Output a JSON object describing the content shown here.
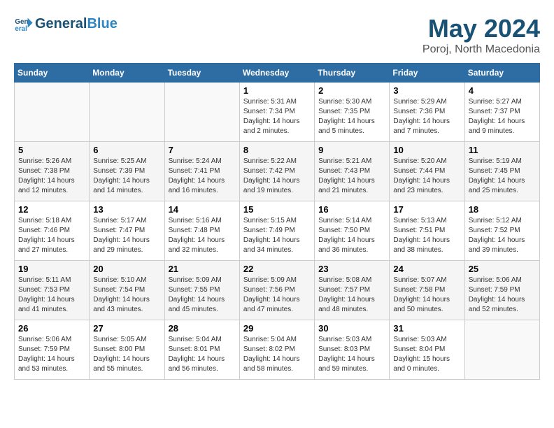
{
  "header": {
    "logo_general": "General",
    "logo_blue": "Blue",
    "month": "May 2024",
    "location": "Poroj, North Macedonia"
  },
  "days_of_week": [
    "Sunday",
    "Monday",
    "Tuesday",
    "Wednesday",
    "Thursday",
    "Friday",
    "Saturday"
  ],
  "weeks": [
    [
      {
        "day": "",
        "info": ""
      },
      {
        "day": "",
        "info": ""
      },
      {
        "day": "",
        "info": ""
      },
      {
        "day": "1",
        "info": "Sunrise: 5:31 AM\nSunset: 7:34 PM\nDaylight: 14 hours and 2 minutes."
      },
      {
        "day": "2",
        "info": "Sunrise: 5:30 AM\nSunset: 7:35 PM\nDaylight: 14 hours and 5 minutes."
      },
      {
        "day": "3",
        "info": "Sunrise: 5:29 AM\nSunset: 7:36 PM\nDaylight: 14 hours and 7 minutes."
      },
      {
        "day": "4",
        "info": "Sunrise: 5:27 AM\nSunset: 7:37 PM\nDaylight: 14 hours and 9 minutes."
      }
    ],
    [
      {
        "day": "5",
        "info": "Sunrise: 5:26 AM\nSunset: 7:38 PM\nDaylight: 14 hours and 12 minutes."
      },
      {
        "day": "6",
        "info": "Sunrise: 5:25 AM\nSunset: 7:39 PM\nDaylight: 14 hours and 14 minutes."
      },
      {
        "day": "7",
        "info": "Sunrise: 5:24 AM\nSunset: 7:41 PM\nDaylight: 14 hours and 16 minutes."
      },
      {
        "day": "8",
        "info": "Sunrise: 5:22 AM\nSunset: 7:42 PM\nDaylight: 14 hours and 19 minutes."
      },
      {
        "day": "9",
        "info": "Sunrise: 5:21 AM\nSunset: 7:43 PM\nDaylight: 14 hours and 21 minutes."
      },
      {
        "day": "10",
        "info": "Sunrise: 5:20 AM\nSunset: 7:44 PM\nDaylight: 14 hours and 23 minutes."
      },
      {
        "day": "11",
        "info": "Sunrise: 5:19 AM\nSunset: 7:45 PM\nDaylight: 14 hours and 25 minutes."
      }
    ],
    [
      {
        "day": "12",
        "info": "Sunrise: 5:18 AM\nSunset: 7:46 PM\nDaylight: 14 hours and 27 minutes."
      },
      {
        "day": "13",
        "info": "Sunrise: 5:17 AM\nSunset: 7:47 PM\nDaylight: 14 hours and 29 minutes."
      },
      {
        "day": "14",
        "info": "Sunrise: 5:16 AM\nSunset: 7:48 PM\nDaylight: 14 hours and 32 minutes."
      },
      {
        "day": "15",
        "info": "Sunrise: 5:15 AM\nSunset: 7:49 PM\nDaylight: 14 hours and 34 minutes."
      },
      {
        "day": "16",
        "info": "Sunrise: 5:14 AM\nSunset: 7:50 PM\nDaylight: 14 hours and 36 minutes."
      },
      {
        "day": "17",
        "info": "Sunrise: 5:13 AM\nSunset: 7:51 PM\nDaylight: 14 hours and 38 minutes."
      },
      {
        "day": "18",
        "info": "Sunrise: 5:12 AM\nSunset: 7:52 PM\nDaylight: 14 hours and 39 minutes."
      }
    ],
    [
      {
        "day": "19",
        "info": "Sunrise: 5:11 AM\nSunset: 7:53 PM\nDaylight: 14 hours and 41 minutes."
      },
      {
        "day": "20",
        "info": "Sunrise: 5:10 AM\nSunset: 7:54 PM\nDaylight: 14 hours and 43 minutes."
      },
      {
        "day": "21",
        "info": "Sunrise: 5:09 AM\nSunset: 7:55 PM\nDaylight: 14 hours and 45 minutes."
      },
      {
        "day": "22",
        "info": "Sunrise: 5:09 AM\nSunset: 7:56 PM\nDaylight: 14 hours and 47 minutes."
      },
      {
        "day": "23",
        "info": "Sunrise: 5:08 AM\nSunset: 7:57 PM\nDaylight: 14 hours and 48 minutes."
      },
      {
        "day": "24",
        "info": "Sunrise: 5:07 AM\nSunset: 7:58 PM\nDaylight: 14 hours and 50 minutes."
      },
      {
        "day": "25",
        "info": "Sunrise: 5:06 AM\nSunset: 7:59 PM\nDaylight: 14 hours and 52 minutes."
      }
    ],
    [
      {
        "day": "26",
        "info": "Sunrise: 5:06 AM\nSunset: 7:59 PM\nDaylight: 14 hours and 53 minutes."
      },
      {
        "day": "27",
        "info": "Sunrise: 5:05 AM\nSunset: 8:00 PM\nDaylight: 14 hours and 55 minutes."
      },
      {
        "day": "28",
        "info": "Sunrise: 5:04 AM\nSunset: 8:01 PM\nDaylight: 14 hours and 56 minutes."
      },
      {
        "day": "29",
        "info": "Sunrise: 5:04 AM\nSunset: 8:02 PM\nDaylight: 14 hours and 58 minutes."
      },
      {
        "day": "30",
        "info": "Sunrise: 5:03 AM\nSunset: 8:03 PM\nDaylight: 14 hours and 59 minutes."
      },
      {
        "day": "31",
        "info": "Sunrise: 5:03 AM\nSunset: 8:04 PM\nDaylight: 15 hours and 0 minutes."
      },
      {
        "day": "",
        "info": ""
      }
    ]
  ]
}
